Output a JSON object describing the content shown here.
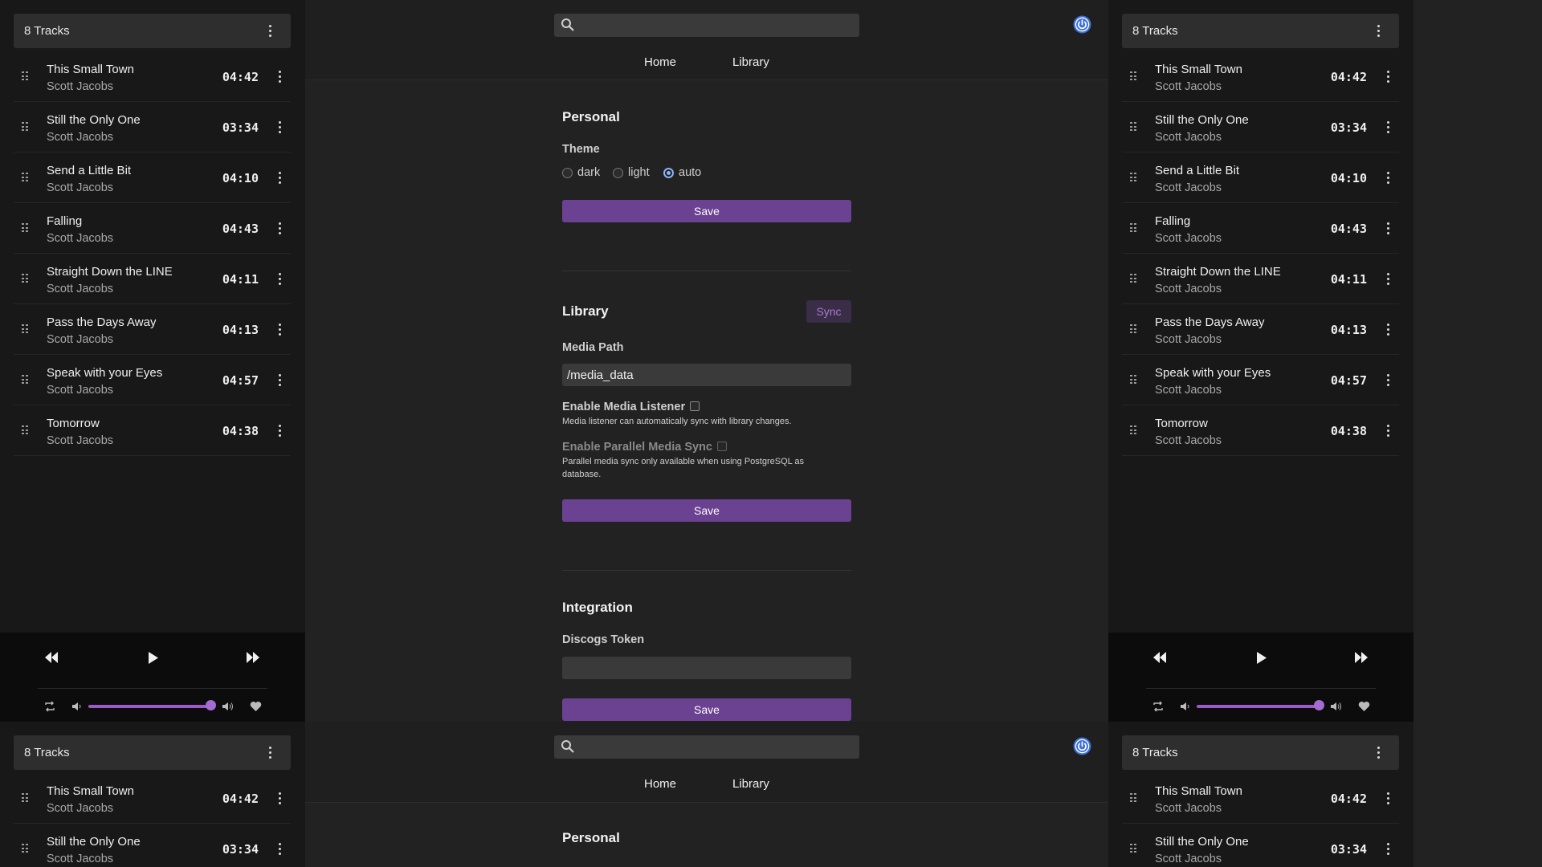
{
  "playlist": {
    "count_label": "8 Tracks",
    "tracks": [
      {
        "title": "This Small Town",
        "artist": "Scott Jacobs",
        "duration": "04:42"
      },
      {
        "title": "Still the Only One",
        "artist": "Scott Jacobs",
        "duration": "03:34"
      },
      {
        "title": "Send a Little Bit",
        "artist": "Scott Jacobs",
        "duration": "04:10"
      },
      {
        "title": "Falling",
        "artist": "Scott Jacobs",
        "duration": "04:43"
      },
      {
        "title": "Straight Down the LINE",
        "artist": "Scott Jacobs",
        "duration": "04:11"
      },
      {
        "title": "Pass the Days Away",
        "artist": "Scott Jacobs",
        "duration": "04:13"
      },
      {
        "title": "Speak with your Eyes",
        "artist": "Scott Jacobs",
        "duration": "04:57"
      },
      {
        "title": "Tomorrow",
        "artist": "Scott Jacobs",
        "duration": "04:38"
      }
    ]
  },
  "player": {
    "volume_level": 1.0,
    "icons": [
      "rewind-icon",
      "play-icon",
      "fast-forward-icon",
      "repeat-icon",
      "volume-low-icon",
      "volume-high-icon",
      "heart-icon"
    ]
  },
  "nav": {
    "search_placeholder": "",
    "home": "Home",
    "library": "Library"
  },
  "settings": {
    "personal": {
      "heading": "Personal",
      "theme_label": "Theme",
      "theme_options": [
        "dark",
        "light",
        "auto"
      ],
      "theme_selected": "auto",
      "save": "Save"
    },
    "library": {
      "heading": "Library",
      "sync": "Sync",
      "media_path_label": "Media Path",
      "media_path_value": "/media_data",
      "listener_label": "Enable Media Listener",
      "listener_help": "Media listener can automatically sync with library changes.",
      "parallel_label": "Enable Parallel Media Sync",
      "parallel_help": "Parallel media sync only available when using PostgreSQL as database.",
      "save": "Save"
    },
    "integration": {
      "heading": "Integration",
      "discogs_label": "Discogs Token",
      "discogs_value": "",
      "save": "Save"
    }
  },
  "colors": {
    "accent": "#6b4191",
    "power_icon": "#3b6fd8",
    "background": "#222222",
    "panel": "#181818"
  }
}
